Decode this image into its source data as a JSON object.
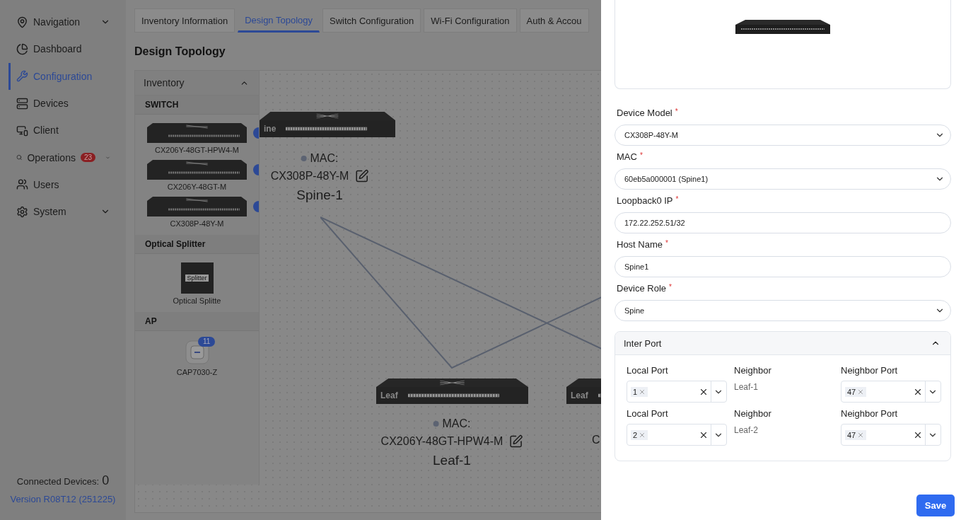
{
  "sidebar": {
    "items": [
      {
        "label": "Navigation",
        "selected": false,
        "expandable": true
      },
      {
        "label": "Dashboard",
        "selected": false,
        "expandable": false
      },
      {
        "label": "Configuration",
        "selected": true,
        "expandable": false
      },
      {
        "label": "Devices",
        "selected": false,
        "expandable": false
      },
      {
        "label": "Client",
        "selected": false,
        "expandable": false
      },
      {
        "label": "Operations",
        "selected": false,
        "expandable": true,
        "badge": "23"
      },
      {
        "label": "Users",
        "selected": false,
        "expandable": false
      },
      {
        "label": "System",
        "selected": false,
        "expandable": true
      }
    ],
    "connected_label": "Connected Devices:",
    "connected_count": "0",
    "version": "Version R08T12 (251225)"
  },
  "tabs": [
    {
      "label": "Inventory Information",
      "selected": false
    },
    {
      "label": "Design Topology",
      "selected": true
    },
    {
      "label": "Switch Configuration",
      "selected": false
    },
    {
      "label": "Wi-Fi Configuration",
      "selected": false
    },
    {
      "label": "Auth & Accou",
      "selected": false
    }
  ],
  "page_title": "Design Topology",
  "inventory": {
    "title": "Inventory",
    "expanded": true,
    "groups": [
      {
        "title": "SWITCH",
        "items": [
          {
            "kind": "switch",
            "name": "CX206Y-48GT-HPW4-M",
            "badge": true
          },
          {
            "kind": "switch",
            "name": "CX206Y-48GT-M",
            "badge": true
          },
          {
            "kind": "switch",
            "name": "CX308P-48Y-M",
            "badge": true
          }
        ]
      },
      {
        "title": "Optical Splitter",
        "items": [
          {
            "kind": "splitter",
            "name": "Optical Splitte",
            "icon_text": "Splitter"
          }
        ]
      },
      {
        "title": "AP",
        "items": [
          {
            "kind": "ap",
            "name": "CAP7030-Z",
            "badge_count": "11"
          }
        ]
      }
    ]
  },
  "topology": {
    "nodes": [
      {
        "role_label": "ine",
        "mac_label": "MAC:",
        "online": false,
        "model": "CX308P-48Y-M",
        "name": "Spine-1"
      },
      {
        "role_label": "Leaf",
        "mac_label": "MAC:",
        "online": false,
        "model": "CX206Y-48GT-HPW4-M",
        "name": "Leaf-1"
      },
      {
        "role_label": "Leaf",
        "model": "C"
      }
    ]
  },
  "drawer": {
    "fields": [
      {
        "label": "Device Model",
        "required_mark": "*",
        "kind": "select",
        "value": "CX308P-48Y-M"
      },
      {
        "label": "MAC",
        "required_mark": "*",
        "kind": "select",
        "value": "60eb5a000001 (Spine1)"
      },
      {
        "label": "Loopback0 IP",
        "required_mark": "*",
        "kind": "input",
        "value": "172.22.252.51/32"
      },
      {
        "label": "Host Name",
        "required_mark": "*",
        "kind": "input",
        "value": "Spine1"
      },
      {
        "label": "Device Role",
        "required_mark": "*",
        "kind": "select",
        "value": "Spine"
      }
    ],
    "inter_port": {
      "title": "Inter Port",
      "expanded": true,
      "rows": [
        {
          "local_label": "Local Port",
          "local_value": "1",
          "neighbor_label": "Neighbor",
          "neighbor": "Leaf-1",
          "neighbor_port_label": "Neighbor Port",
          "neighbor_port_value": "47"
        },
        {
          "local_label": "Local Port",
          "local_value": "2",
          "neighbor_label": "Neighbor",
          "neighbor": "Leaf-2",
          "neighbor_port_label": "Neighbor Port",
          "neighbor_port_value": "47"
        }
      ]
    },
    "save": "Save"
  }
}
